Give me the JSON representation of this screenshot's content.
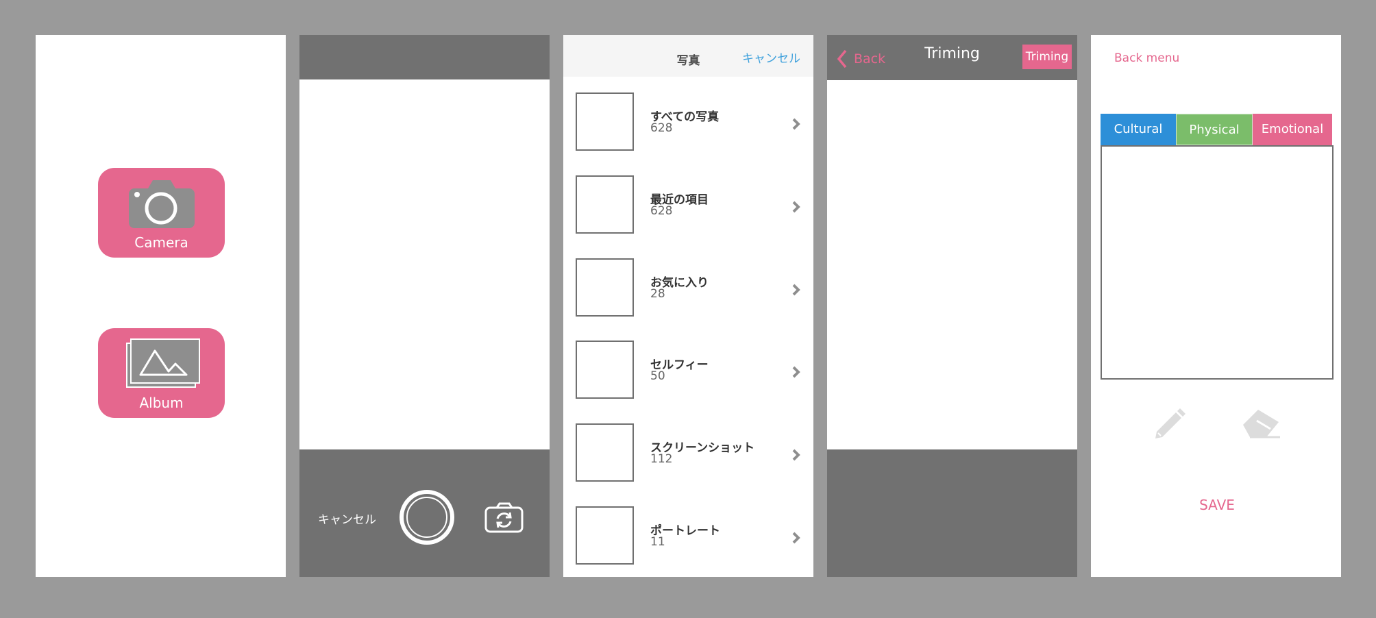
{
  "colors": {
    "background": "#9a9a9a",
    "accent_pink": "#e5678e",
    "bar_gray": "#717171",
    "link_blue": "#3da0dc",
    "tab_blue": "#2d8fd8",
    "tab_green": "#7bbd6a"
  },
  "home": {
    "camera_label": "Camera",
    "album_label": "Album",
    "camera_icon": "camera-icon",
    "album_icon": "album-photos-icon"
  },
  "camera_view": {
    "cancel_label": "キャンセル",
    "shutter_icon": "shutter-button-icon",
    "flip_icon": "switch-camera-icon"
  },
  "album_picker": {
    "title": "写真",
    "cancel_label": "キャンセル",
    "albums": [
      {
        "name": "すべての写真",
        "count": "628"
      },
      {
        "name": "最近の項目",
        "count": "628"
      },
      {
        "name": "お気に入り",
        "count": "28"
      },
      {
        "name": "セルフィー",
        "count": "50"
      },
      {
        "name": "スクリーンショット",
        "count": "112"
      },
      {
        "name": "ポートレート",
        "count": "11"
      }
    ]
  },
  "trim_view": {
    "back_label": "Back",
    "title": "Triming",
    "trim_button": "Triming"
  },
  "editor": {
    "back_menu": "Back menu",
    "tabs": [
      "Cultural",
      "Physical",
      "Emotional"
    ],
    "pencil_icon": "pencil-icon",
    "eraser_icon": "eraser-icon",
    "save_label": "SAVE"
  }
}
